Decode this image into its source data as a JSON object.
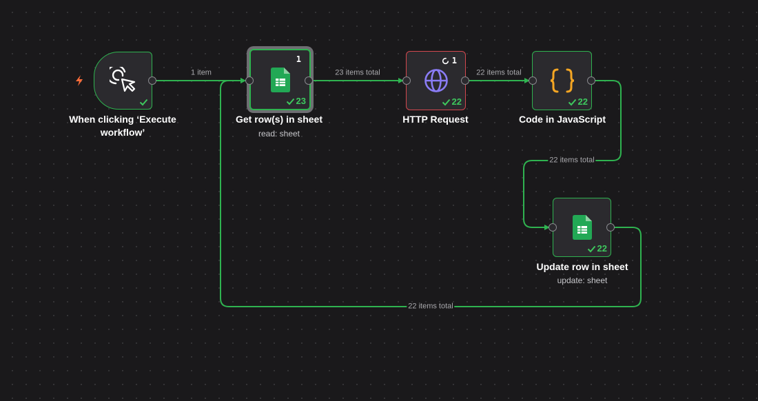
{
  "colors": {
    "canvas_background": "#1a191b",
    "node_background": "#2b2a2e",
    "success": "#2fb350",
    "success_text": "#3ec95e",
    "error_border": "#d4484f",
    "edge_label": "#a9a9ad",
    "trigger_bolt": "#ff6d3a",
    "http_globe": "#8a7cf5",
    "code_braces": "#f5a623",
    "sheets_green": "#22a855"
  },
  "nodes": {
    "trigger": {
      "title": "When clicking ‘Execute workflow’",
      "icon": "cursor-click-icon",
      "status": "success",
      "extra_icon": "lightning-bolt-icon"
    },
    "get_rows": {
      "title": "Get row(s) in sheet",
      "subtitle": "read: sheet",
      "icon": "google-sheets-icon",
      "status_count": "23",
      "badge": "1",
      "selected": true
    },
    "http": {
      "title": "HTTP Request",
      "icon": "globe-icon",
      "status_count": "22",
      "badge": "1",
      "badge_icon": "refresh-icon",
      "state": "error-border"
    },
    "code": {
      "title": "Code in JavaScript",
      "icon": "code-braces-icon",
      "status_count": "22"
    },
    "update_row": {
      "title": "Update row in sheet",
      "subtitle": "update: sheet",
      "icon": "google-sheets-icon",
      "status_count": "22"
    }
  },
  "edges": {
    "trigger_to_get": "1 item",
    "get_to_http": "23 items total",
    "http_to_code": "22 items total",
    "code_to_update": "22 items total",
    "update_to_get": "22 items total"
  }
}
